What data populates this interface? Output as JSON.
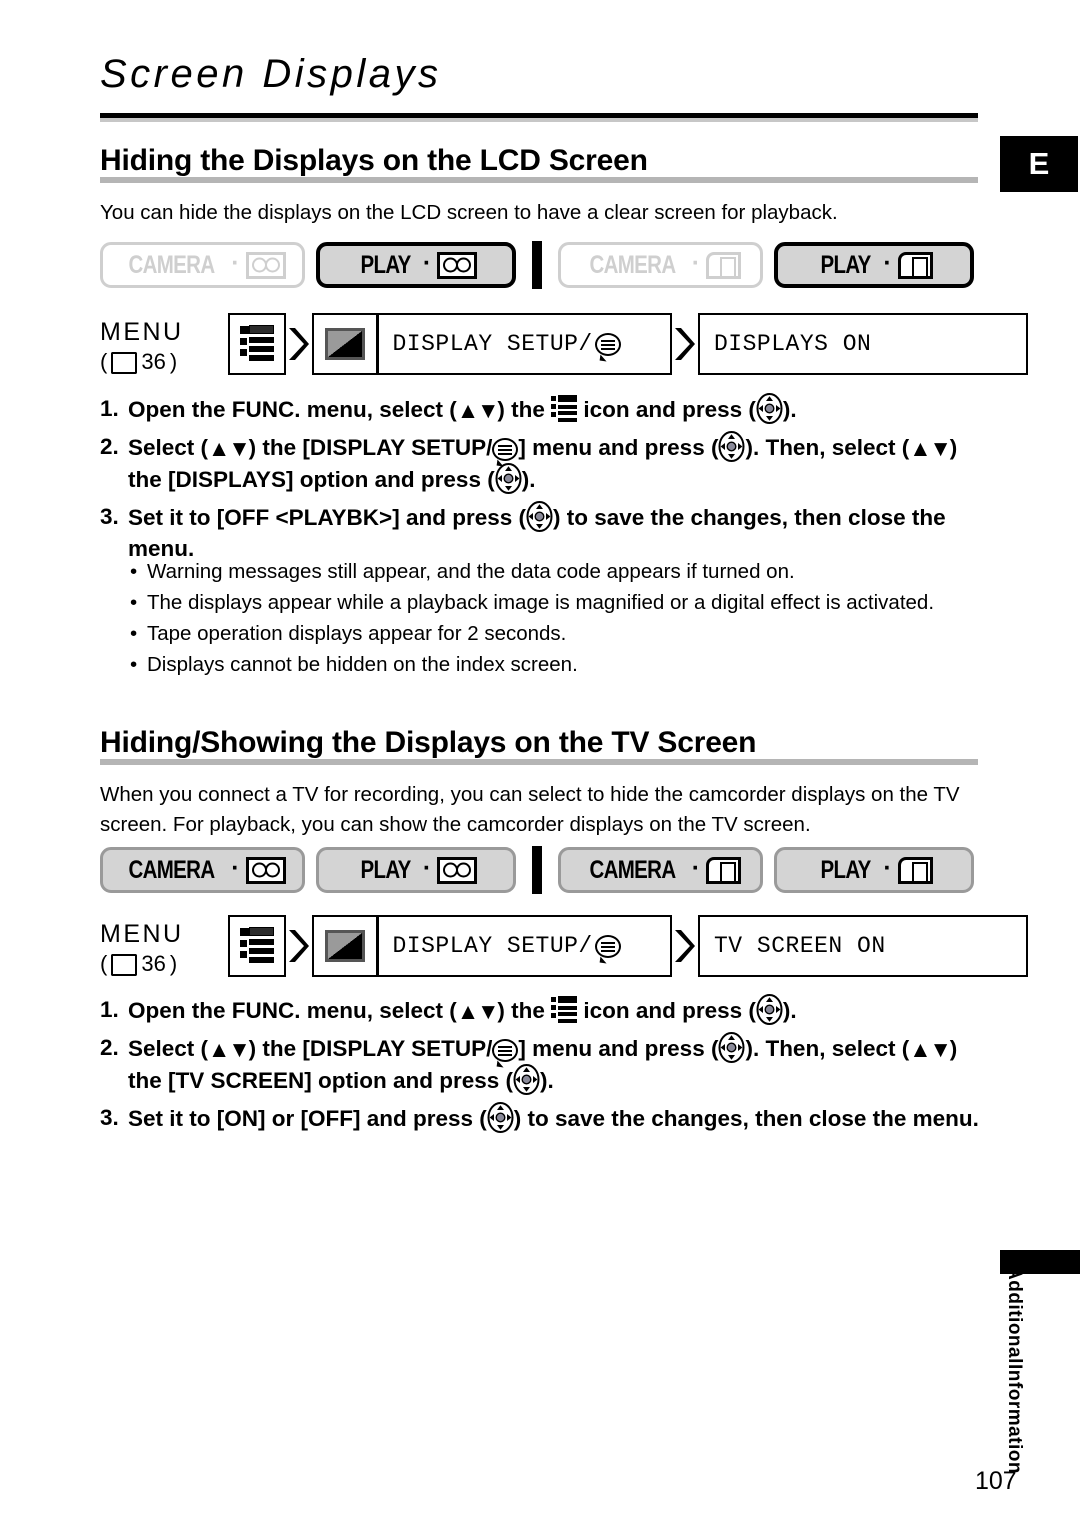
{
  "chapter": {
    "title": "Screen Displays",
    "lang_badge": "E",
    "page_number": "107"
  },
  "section1": {
    "heading": "Hiding the Displays on the LCD Screen",
    "intro": "You can hide the displays on the LCD screen to have a clear screen for playback.",
    "modes": [
      {
        "label": "CAMERA",
        "icon": "tape-icon",
        "state": "inactive"
      },
      {
        "label": "PLAY",
        "icon": "tape-icon",
        "state": "active"
      },
      {
        "label": "CAMERA",
        "icon": "card-icon",
        "state": "inactive"
      },
      {
        "label": "PLAY",
        "icon": "card-icon",
        "state": "active"
      }
    ],
    "menu": {
      "word": "MENU",
      "page_ref": "36",
      "icon1": "menu-list-icon",
      "step2_icon": "display-setup-gradient-icon",
      "step2_label": "DISPLAY SETUP/",
      "step2_suffix_icon": "speech-bubble-icon",
      "step3_label": "DISPLAYS ON"
    },
    "steps": [
      {
        "num": "1.",
        "pre": "Open the FUNC. menu, select (",
        "arrows": "▲▼",
        "mid": ") the ",
        "icon": "menu-list-icon",
        "post": " icon and press (",
        "joy": "joystick-icon",
        "end": ")."
      },
      {
        "num": "2.",
        "pre": "Select (",
        "arrows": "▲▼",
        "mid": ") the [DISPLAY SETUP/",
        "bubble": "speech-bubble-icon",
        "post": "] menu and press (",
        "joy": "joystick-icon",
        "end": "). Then, select (",
        "arrows2": "▲▼",
        "mid2": ") the [DISPLAYS] option and press (",
        "joy2": "joystick-icon",
        "end2": ")."
      },
      {
        "num": "3.",
        "pre": "Set it to [OFF <PLAYBK>] and press (",
        "joy": "joystick-icon",
        "post": ") to save the changes, then close the menu."
      }
    ],
    "bullets": [
      "Warning messages still appear, and the data code appears if turned on.",
      "The displays appear while a playback image is magnified or a digital effect is activated.",
      "Tape operation displays appear for 2 seconds.",
      "Displays cannot be hidden on the index screen."
    ]
  },
  "section2": {
    "heading": "Hiding/Showing the Displays on the TV Screen",
    "intro": "When you connect a TV for recording, you can select to hide the camcorder displays on the TV screen. For playback, you can show the camcorder displays on the TV screen.",
    "modes": [
      {
        "label": "CAMERA",
        "icon": "tape-icon",
        "state": "plain"
      },
      {
        "label": "PLAY",
        "icon": "tape-icon",
        "state": "plain"
      },
      {
        "label": "CAMERA",
        "icon": "card-icon",
        "state": "plain"
      },
      {
        "label": "PLAY",
        "icon": "card-icon",
        "state": "plain"
      }
    ],
    "menu": {
      "word": "MENU",
      "page_ref": "36",
      "icon1": "menu-list-icon",
      "step2_icon": "display-setup-gradient-icon",
      "step2_label": "DISPLAY SETUP/",
      "step2_suffix_icon": "speech-bubble-icon",
      "step3_label": "TV SCREEN ON"
    },
    "steps": [
      {
        "num": "1.",
        "pre": "Open the FUNC. menu, select (",
        "arrows": "▲▼",
        "mid": ") the ",
        "icon": "menu-list-icon",
        "post": " icon and press (",
        "joy": "joystick-icon",
        "end": ")."
      },
      {
        "num": "2.",
        "pre": "Select (",
        "arrows": "▲▼",
        "mid": ") the [DISPLAY SETUP/",
        "bubble": "speech-bubble-icon",
        "post": "] menu and press (",
        "joy": "joystick-icon",
        "end": "). Then, select (",
        "arrows2": "▲▼",
        "mid2": ") the [TV SCREEN] option and press (",
        "joy2": "joystick-icon",
        "end2": ")."
      },
      {
        "num": "3.",
        "pre": "Set it to [ON] or [OFF] and press (",
        "joy": "joystick-icon",
        "post": ") to save the changes, then close the menu."
      }
    ]
  },
  "side_tab": {
    "line1": "Additional",
    "line2": "Information"
  }
}
